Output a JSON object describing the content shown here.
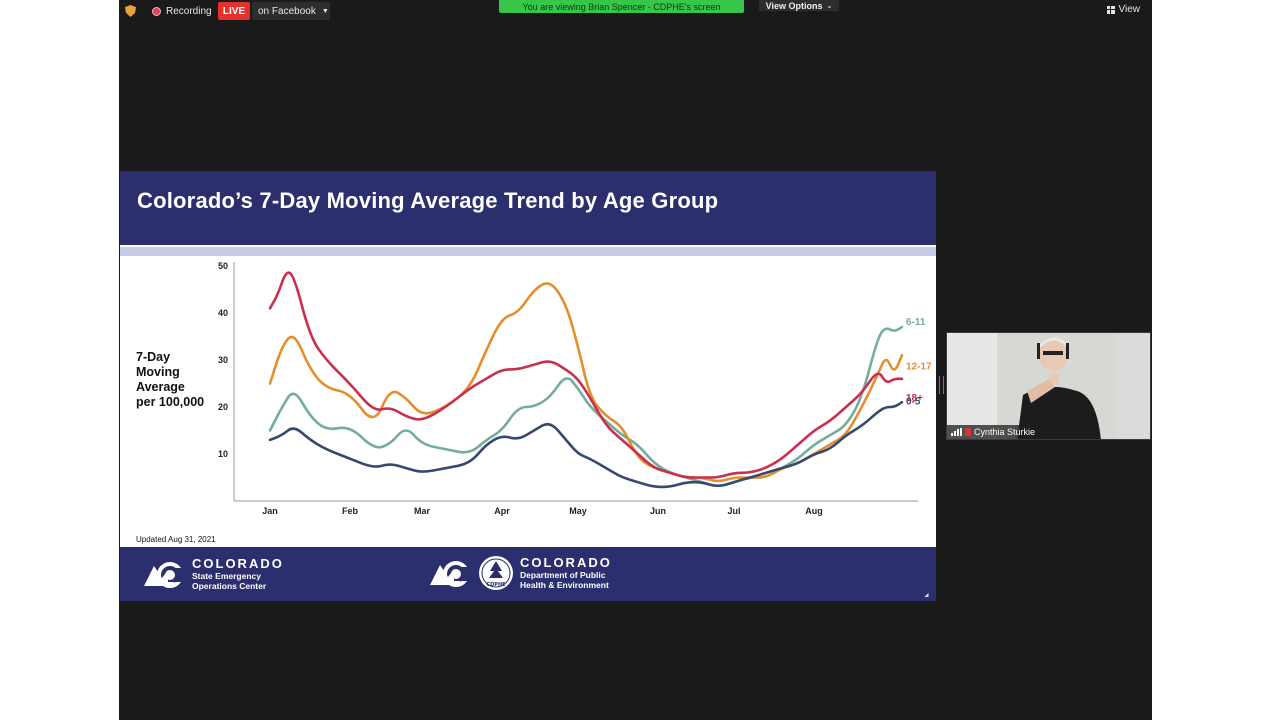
{
  "zoom_bar": {
    "recording_label": "Recording",
    "live_label": "LIVE",
    "stream_target_label": "on Facebook",
    "viewing_banner": "You are viewing Brian Spencer - CDPHE's screen",
    "view_options_label": "View Options",
    "view_label": "View"
  },
  "slide": {
    "title": "Colorado’s 7-Day Moving Average Trend by Age Group",
    "updated_note": "Updated Aug 31, 2021",
    "ylabel_lines": [
      "7-Day",
      "Moving",
      "Average",
      "per 100,000"
    ],
    "footer_left": {
      "word": "COLORADO",
      "sub1": "State Emergency",
      "sub2": "Operations Center"
    },
    "footer_right": {
      "word": "COLORADO",
      "sub1": "Department of Public",
      "sub2": "Health & Environment",
      "seal_text": "CDPHE"
    }
  },
  "chart_data": {
    "type": "line",
    "ylabel": "7-Day Moving Average per 100,000",
    "ylim": [
      0,
      50
    ],
    "yticks": [
      10,
      20,
      30,
      40,
      50
    ],
    "x_tick_labels": [
      "Jan",
      "Feb",
      "Mar",
      "Apr",
      "May",
      "Jun",
      "Jul",
      "Aug"
    ],
    "x_tick_positions": [
      0.3,
      1.3,
      2.2,
      3.2,
      4.15,
      5.15,
      6.1,
      7.1
    ],
    "xlim": [
      -0.15,
      8.4
    ],
    "grid": false,
    "legend_placement": "line-end labels",
    "series": [
      {
        "name": "6-11",
        "color": "#74ad9c",
        "x": [
          0.3,
          0.45,
          0.6,
          0.8,
          1.0,
          1.3,
          1.6,
          1.8,
          2.0,
          2.2,
          2.5,
          2.8,
          3.0,
          3.2,
          3.4,
          3.6,
          3.8,
          4.0,
          4.15,
          4.3,
          4.5,
          4.7,
          4.9,
          5.1,
          5.3,
          5.5,
          5.7,
          5.9,
          6.1,
          6.3,
          6.5,
          6.7,
          6.9,
          7.1,
          7.3,
          7.5,
          7.7,
          7.9,
          8.0,
          8.1,
          8.2
        ],
        "values": [
          15,
          20,
          24,
          18,
          15,
          16,
          11,
          12,
          16,
          12,
          11,
          10,
          13,
          15,
          20,
          20,
          22,
          27,
          24,
          20,
          17,
          14,
          12,
          8,
          6,
          5,
          4,
          3,
          4,
          5,
          5,
          7,
          9,
          12,
          14,
          16,
          22,
          35,
          37,
          36,
          37
        ]
      },
      {
        "name": "12-17",
        "color": "#e48f2d",
        "x": [
          0.3,
          0.45,
          0.6,
          0.8,
          1.0,
          1.3,
          1.6,
          1.8,
          2.0,
          2.2,
          2.5,
          2.8,
          3.0,
          3.2,
          3.4,
          3.6,
          3.8,
          4.0,
          4.15,
          4.3,
          4.5,
          4.7,
          4.9,
          5.1,
          5.3,
          5.5,
          5.7,
          5.9,
          6.1,
          6.3,
          6.5,
          6.7,
          6.9,
          7.1,
          7.3,
          7.5,
          7.7,
          7.9,
          8.0,
          8.1,
          8.2
        ],
        "values": [
          25,
          33,
          36,
          28,
          24,
          23,
          16,
          24,
          22,
          18,
          20,
          24,
          32,
          39,
          40,
          45,
          47,
          42,
          33,
          22,
          18,
          16,
          9,
          7,
          6,
          5,
          5,
          4,
          5,
          5,
          5,
          7,
          8,
          10,
          12,
          14,
          20,
          27,
          31,
          27,
          31
        ]
      },
      {
        "name": "18+",
        "color": "#c9304f",
        "x": [
          0.3,
          0.4,
          0.5,
          0.6,
          0.8,
          1.0,
          1.3,
          1.6,
          1.8,
          2.0,
          2.2,
          2.5,
          2.8,
          3.0,
          3.2,
          3.4,
          3.6,
          3.8,
          4.0,
          4.15,
          4.3,
          4.5,
          4.7,
          4.9,
          5.1,
          5.3,
          5.5,
          5.7,
          5.9,
          6.1,
          6.3,
          6.5,
          6.7,
          6.9,
          7.1,
          7.3,
          7.5,
          7.7,
          7.9,
          8.0,
          8.1,
          8.2
        ],
        "values": [
          41,
          44,
          49,
          48,
          35,
          30,
          25,
          19,
          20,
          18,
          17,
          20,
          24,
          26,
          28,
          28,
          29,
          30,
          28,
          26,
          22,
          16,
          13,
          10,
          7,
          6,
          5,
          5,
          5,
          6,
          6,
          7,
          9,
          12,
          15,
          17,
          20,
          23,
          28,
          25,
          26,
          26
        ]
      },
      {
        "name": "0-5",
        "color": "#354a6d",
        "x": [
          0.3,
          0.45,
          0.6,
          0.8,
          1.0,
          1.3,
          1.6,
          1.8,
          2.0,
          2.2,
          2.5,
          2.8,
          3.0,
          3.2,
          3.4,
          3.6,
          3.8,
          4.0,
          4.15,
          4.3,
          4.5,
          4.7,
          4.9,
          5.1,
          5.3,
          5.5,
          5.7,
          5.9,
          6.1,
          6.3,
          6.5,
          6.7,
          6.9,
          7.1,
          7.3,
          7.5,
          7.7,
          7.9,
          8.0,
          8.1,
          8.2
        ],
        "values": [
          13,
          14,
          16,
          13,
          11,
          9,
          7,
          8,
          7,
          6,
          7,
          8,
          12,
          14,
          13,
          15,
          17,
          13,
          10,
          9,
          7,
          5,
          4,
          3,
          3,
          4,
          4,
          3,
          4,
          5,
          6,
          7,
          8,
          10,
          11,
          14,
          16,
          19,
          20,
          20,
          21
        ]
      }
    ]
  },
  "video": {
    "participant_name": "Cynthia Sturkie"
  }
}
